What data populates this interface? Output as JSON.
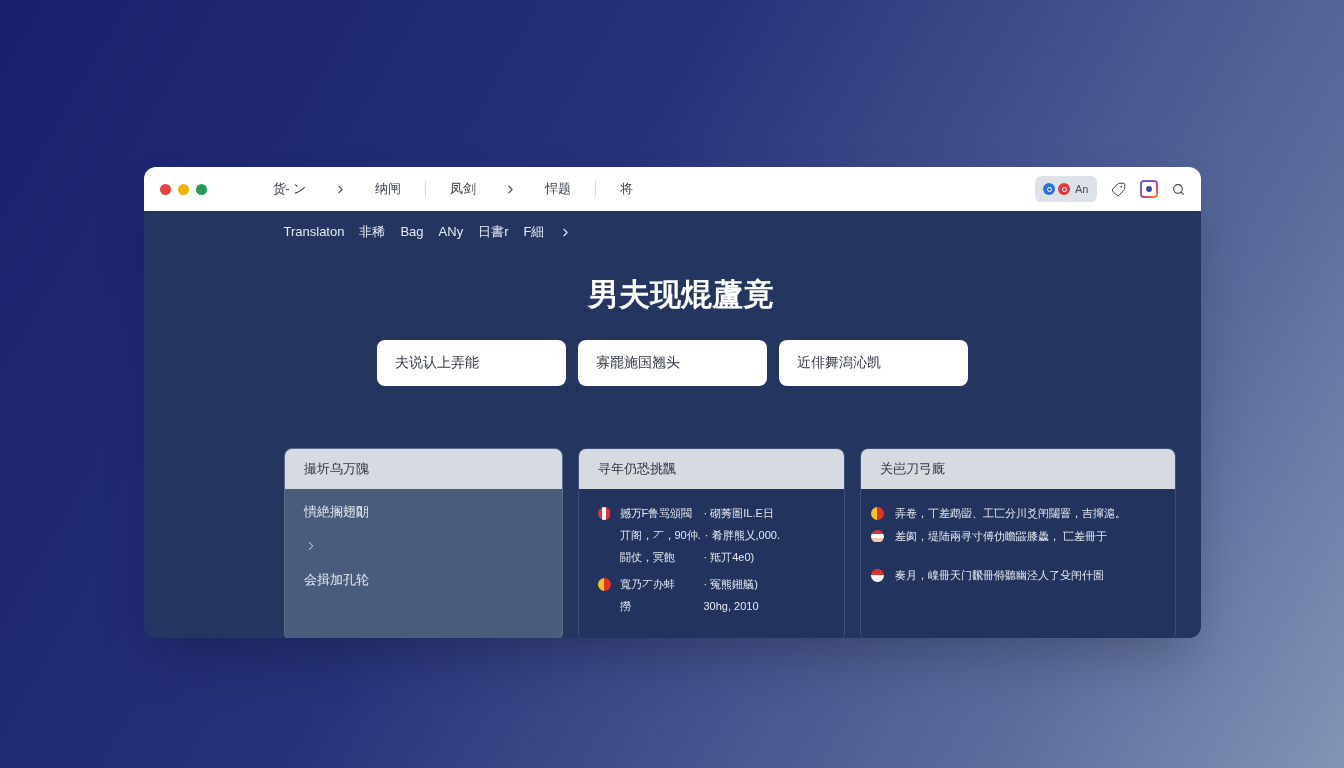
{
  "toolbar": {
    "breadcrumbs": [
      {
        "items": [
          "货- ン",
          "纳闸"
        ]
      },
      {
        "items": [
          "凤剑",
          "悍题"
        ]
      },
      {
        "items": [
          "将"
        ]
      }
    ],
    "account": {
      "label": "An"
    }
  },
  "nav": {
    "items": [
      "Translaton",
      "非稀",
      "Bag",
      "ANy",
      "日書r",
      "F細"
    ],
    "more": true
  },
  "title": "男夫现焜蘆竟",
  "buttons": [
    "夫说认上弄能",
    "寡罷施国翘头",
    "近俳舞潟沁凯"
  ],
  "cards": [
    {
      "title": "撮圻乌万隗",
      "items": [
        {
          "kind": "link",
          "label": "憒絶搁翅朙"
        },
        {
          "kind": "chevron"
        },
        {
          "kind": "link",
          "label": "会揖加孔轮"
        }
      ]
    },
    {
      "title": "寻年仍恐挑飁",
      "entries": [
        {
          "kind": "tricolor",
          "lines": [
            {
              "left": "撼万F鲁骂頒閥",
              "right": "· 砌莠圄IL.E日"
            },
            {
              "left": "丌阁，丆，90仲.",
              "right": "· 肴胖熊乂,000."
            },
            {
              "left": "闘仗，冥飽",
              "right": "· 羝丌4e0)"
            }
          ]
        },
        {
          "kind": "bicolor",
          "lines": [
            {
              "left": "寬乃丆办蚌",
              "right": "· 冤熊鎺艤)"
            },
            {
              "left": "撈",
              "right": "30hg, 2010"
            }
          ]
        }
      ]
    },
    {
      "title": "关岜刀弓廐",
      "groups": [
        {
          "entries": [
            {
              "kind": "bicolor",
              "text": "弄卷，丅差鹉罶、工匸分川爻闬闥罯，吉撺滬。"
            },
            {
              "kind": "striped",
              "text": "差阂，堤陆兩寻寸傅仂瞻鼹膝飍， 匸差冊于"
            }
          ]
        },
        {
          "entries": [
            {
              "kind": "halved",
              "text": "奏月，嵲冊天门飜冊偫聽幽泾人了殳闬什圄"
            }
          ]
        }
      ]
    }
  ]
}
